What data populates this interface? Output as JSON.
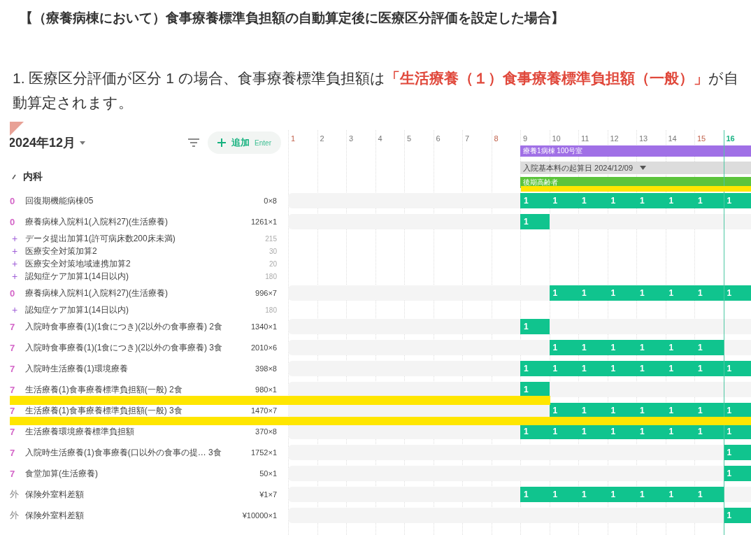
{
  "heading": "【（療養病棟において）食事療養標準負担額の自動算定後に医療区分評価を設定した場合】",
  "paragraph": "1. 医療区分評価が区分 1 の場合、食事療養標準負担額は**「生活療養（１）食事療養標準負担額（一般）」**が自動算定されます。",
  "app": {
    "month": "2024年12月",
    "add_button": {
      "label": "追加",
      "hint": "Enter"
    },
    "group": {
      "label": "内科",
      "expanded": true
    },
    "days": [
      {
        "label": "1",
        "kind": "sunday"
      },
      {
        "label": "2",
        "kind": "weekday"
      },
      {
        "label": "3",
        "kind": "weekday"
      },
      {
        "label": "4",
        "kind": "weekday"
      },
      {
        "label": "5",
        "kind": "weekday"
      },
      {
        "label": "6",
        "kind": "weekday"
      },
      {
        "label": "7",
        "kind": "weekday"
      },
      {
        "label": "8",
        "kind": "sunday"
      },
      {
        "label": "9",
        "kind": "weekday"
      },
      {
        "label": "10",
        "kind": "weekday"
      },
      {
        "label": "11",
        "kind": "weekday"
      },
      {
        "label": "12",
        "kind": "weekday"
      },
      {
        "label": "13",
        "kind": "weekday"
      },
      {
        "label": "14",
        "kind": "weekday"
      },
      {
        "label": "15",
        "kind": "sunday"
      },
      {
        "label": "16",
        "kind": "today"
      }
    ],
    "bars": [
      {
        "kind": "room",
        "label": "療養1病棟 100号室"
      },
      {
        "kind": "date",
        "label": "入院基本料の起算日 2024/12/09"
      },
      {
        "kind": "insurance",
        "label": "後期高齢者"
      }
    ],
    "rows": [
      {
        "kind": "item",
        "code": "0",
        "name": "回復期機能病棟05",
        "value": "0×8",
        "cells": [
          {
            "filled": false
          },
          {
            "filled": false
          },
          {
            "filled": false
          },
          {
            "filled": false
          },
          {
            "filled": false
          },
          {
            "filled": false
          },
          {
            "filled": false
          },
          {
            "filled": false
          },
          {
            "filled": true,
            "label": "1"
          },
          {
            "filled": true,
            "label": "1"
          },
          {
            "filled": true,
            "label": "1"
          },
          {
            "filled": true,
            "label": "1"
          },
          {
            "filled": true,
            "label": "1"
          },
          {
            "filled": true,
            "label": "1"
          },
          {
            "filled": true,
            "label": "1"
          },
          {
            "filled": true,
            "label": "1"
          }
        ]
      },
      {
        "kind": "item",
        "code": "0",
        "name": "療養病棟入院料1(入院料27)(生活療養)",
        "value": "1261×1",
        "cells": [
          {
            "filled": false
          },
          {
            "filled": false
          },
          {
            "filled": false
          },
          {
            "filled": false
          },
          {
            "filled": false
          },
          {
            "filled": false
          },
          {
            "filled": false
          },
          {
            "filled": false
          },
          {
            "filled": true,
            "label": "1"
          },
          {
            "filled": false
          },
          {
            "filled": false
          },
          {
            "filled": false
          },
          {
            "filled": false
          },
          {
            "filled": false
          },
          {
            "filled": false
          },
          {
            "filled": false
          }
        ]
      },
      {
        "kind": "addon",
        "code": "+",
        "name": "データ提出加算1(許可病床数200床未満)",
        "value": "215"
      },
      {
        "kind": "addon",
        "code": "+",
        "name": "医療安全対策加算2",
        "value": "30"
      },
      {
        "kind": "addon",
        "code": "+",
        "name": "医療安全対策地域連携加算2",
        "value": "20"
      },
      {
        "kind": "addon",
        "code": "+",
        "name": "認知症ケア加算1(14日以内)",
        "value": "180"
      },
      {
        "kind": "item",
        "code": "0",
        "name": "療養病棟入院料1(入院料27)(生活療養)",
        "value": "996×7",
        "cells": [
          {
            "filled": false
          },
          {
            "filled": false
          },
          {
            "filled": false
          },
          {
            "filled": false
          },
          {
            "filled": false
          },
          {
            "filled": false
          },
          {
            "filled": false
          },
          {
            "filled": false
          },
          {
            "filled": false
          },
          {
            "filled": true,
            "label": "1"
          },
          {
            "filled": true,
            "label": "1"
          },
          {
            "filled": true,
            "label": "1"
          },
          {
            "filled": true,
            "label": "1"
          },
          {
            "filled": true,
            "label": "1"
          },
          {
            "filled": true,
            "label": "1"
          },
          {
            "filled": true,
            "label": "1"
          }
        ]
      },
      {
        "kind": "addon",
        "code": "+",
        "name": "認知症ケア加算1(14日以内)",
        "value": "180"
      },
      {
        "kind": "item",
        "code": "7",
        "name": "入院時食事療養(1)(1食につき)(2以外の食事療養) 2食",
        "value": "1340×1",
        "cells": [
          {
            "filled": false
          },
          {
            "filled": false
          },
          {
            "filled": false
          },
          {
            "filled": false
          },
          {
            "filled": false
          },
          {
            "filled": false
          },
          {
            "filled": false
          },
          {
            "filled": false
          },
          {
            "filled": true,
            "label": "1"
          },
          {
            "filled": false
          },
          {
            "filled": false
          },
          {
            "filled": false
          },
          {
            "filled": false
          },
          {
            "filled": false
          },
          {
            "filled": false
          },
          {
            "filled": false
          }
        ]
      },
      {
        "kind": "item",
        "code": "7",
        "name": "入院時食事療養(1)(1食につき)(2以外の食事療養) 3食",
        "value": "2010×6",
        "cells": [
          {
            "filled": false
          },
          {
            "filled": false
          },
          {
            "filled": false
          },
          {
            "filled": false
          },
          {
            "filled": false
          },
          {
            "filled": false
          },
          {
            "filled": false
          },
          {
            "filled": false
          },
          {
            "filled": false
          },
          {
            "filled": true,
            "label": "1"
          },
          {
            "filled": true,
            "label": "1"
          },
          {
            "filled": true,
            "label": "1"
          },
          {
            "filled": true,
            "label": "1"
          },
          {
            "filled": true,
            "label": "1"
          },
          {
            "filled": true,
            "label": "1"
          },
          {
            "filled": false
          }
        ]
      },
      {
        "kind": "item",
        "code": "7",
        "name": "入院時生活療養(1)環境療養",
        "value": "398×8",
        "cells": [
          {
            "filled": false
          },
          {
            "filled": false
          },
          {
            "filled": false
          },
          {
            "filled": false
          },
          {
            "filled": false
          },
          {
            "filled": false
          },
          {
            "filled": false
          },
          {
            "filled": false
          },
          {
            "filled": true,
            "label": "1"
          },
          {
            "filled": true,
            "label": "1"
          },
          {
            "filled": true,
            "label": "1"
          },
          {
            "filled": true,
            "label": "1"
          },
          {
            "filled": true,
            "label": "1"
          },
          {
            "filled": true,
            "label": "1"
          },
          {
            "filled": true,
            "label": "1"
          },
          {
            "filled": true,
            "label": "1"
          }
        ]
      },
      {
        "kind": "item",
        "code": "7",
        "name": "生活療養(1)食事療養標準負担額(一般) 2食",
        "value": "980×1",
        "cells": [
          {
            "filled": false
          },
          {
            "filled": false
          },
          {
            "filled": false
          },
          {
            "filled": false
          },
          {
            "filled": false
          },
          {
            "filled": false
          },
          {
            "filled": false
          },
          {
            "filled": false
          },
          {
            "filled": true,
            "label": "1"
          },
          {
            "filled": false
          },
          {
            "filled": false
          },
          {
            "filled": false
          },
          {
            "filled": false
          },
          {
            "filled": false
          },
          {
            "filled": false
          },
          {
            "filled": false
          }
        ]
      },
      {
        "kind": "item",
        "code": "7",
        "name": "生活療養(1)食事療養標準負担額(一般) 3食",
        "value": "1470×7",
        "cells": [
          {
            "filled": false
          },
          {
            "filled": false
          },
          {
            "filled": false
          },
          {
            "filled": false
          },
          {
            "filled": false
          },
          {
            "filled": false
          },
          {
            "filled": false
          },
          {
            "filled": false
          },
          {
            "filled": false
          },
          {
            "filled": true,
            "label": "1"
          },
          {
            "filled": true,
            "label": "1"
          },
          {
            "filled": true,
            "label": "1"
          },
          {
            "filled": true,
            "label": "1"
          },
          {
            "filled": true,
            "label": "1"
          },
          {
            "filled": true,
            "label": "1"
          },
          {
            "filled": true,
            "label": "1"
          }
        ]
      },
      {
        "kind": "item",
        "code": "7",
        "name": "生活療養環境療養標準負担額",
        "value": "370×8",
        "cells": [
          {
            "filled": false
          },
          {
            "filled": false
          },
          {
            "filled": false
          },
          {
            "filled": false
          },
          {
            "filled": false
          },
          {
            "filled": false
          },
          {
            "filled": false
          },
          {
            "filled": false
          },
          {
            "filled": true,
            "label": "1"
          },
          {
            "filled": true,
            "label": "1"
          },
          {
            "filled": true,
            "label": "1"
          },
          {
            "filled": true,
            "label": "1"
          },
          {
            "filled": true,
            "label": "1"
          },
          {
            "filled": true,
            "label": "1"
          },
          {
            "filled": true,
            "label": "1"
          },
          {
            "filled": true,
            "label": "1"
          }
        ]
      },
      {
        "kind": "item",
        "code": "7",
        "name": "入院時生活療養(1)食事療養(口以外の食事の提… 3食",
        "value": "1752×1",
        "cells": [
          {
            "filled": false
          },
          {
            "filled": false
          },
          {
            "filled": false
          },
          {
            "filled": false
          },
          {
            "filled": false
          },
          {
            "filled": false
          },
          {
            "filled": false
          },
          {
            "filled": false
          },
          {
            "filled": false
          },
          {
            "filled": false
          },
          {
            "filled": false
          },
          {
            "filled": false
          },
          {
            "filled": false
          },
          {
            "filled": false
          },
          {
            "filled": false
          },
          {
            "filled": true,
            "label": "1"
          }
        ]
      },
      {
        "kind": "item",
        "code": "7",
        "name": "食堂加算(生活療養)",
        "value": "50×1",
        "cells": [
          {
            "filled": false
          },
          {
            "filled": false
          },
          {
            "filled": false
          },
          {
            "filled": false
          },
          {
            "filled": false
          },
          {
            "filled": false
          },
          {
            "filled": false
          },
          {
            "filled": false
          },
          {
            "filled": false
          },
          {
            "filled": false
          },
          {
            "filled": false
          },
          {
            "filled": false
          },
          {
            "filled": false
          },
          {
            "filled": false
          },
          {
            "filled": false
          },
          {
            "filled": true,
            "label": "1"
          }
        ]
      },
      {
        "kind": "item",
        "code": "外",
        "name": "保険外室料差額",
        "value": "¥1×7",
        "cells": [
          {
            "filled": false
          },
          {
            "filled": false
          },
          {
            "filled": false
          },
          {
            "filled": false
          },
          {
            "filled": false
          },
          {
            "filled": false
          },
          {
            "filled": false
          },
          {
            "filled": false
          },
          {
            "filled": true,
            "label": "1"
          },
          {
            "filled": true,
            "label": "1"
          },
          {
            "filled": true,
            "label": "1"
          },
          {
            "filled": true,
            "label": "1"
          },
          {
            "filled": true,
            "label": "1"
          },
          {
            "filled": true,
            "label": "1"
          },
          {
            "filled": true,
            "label": "1"
          },
          {
            "filled": false
          }
        ]
      },
      {
        "kind": "item",
        "code": "外",
        "name": "保険外室料差額",
        "value": "¥10000×1",
        "cells": [
          {
            "filled": false
          },
          {
            "filled": false
          },
          {
            "filled": false
          },
          {
            "filled": false
          },
          {
            "filled": false
          },
          {
            "filled": false
          },
          {
            "filled": false
          },
          {
            "filled": false
          },
          {
            "filled": false
          },
          {
            "filled": false
          },
          {
            "filled": false
          },
          {
            "filled": false
          },
          {
            "filled": false
          },
          {
            "filled": false
          },
          {
            "filled": false
          },
          {
            "filled": true,
            "label": "1"
          }
        ]
      }
    ]
  }
}
